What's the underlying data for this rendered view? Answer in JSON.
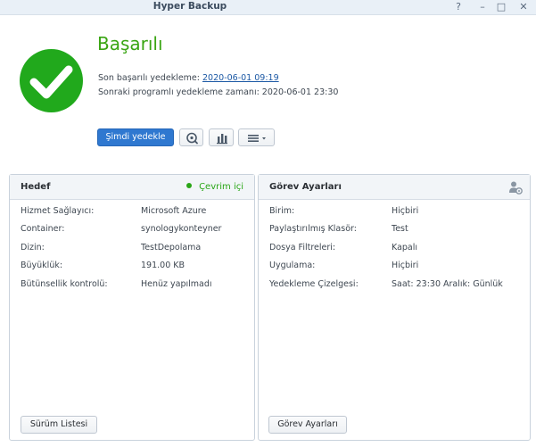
{
  "window": {
    "title": "Hyper Backup",
    "help_glyph": "?",
    "minimize_glyph": "–",
    "maximize_glyph": "□",
    "close_glyph": "✕"
  },
  "status": {
    "icon": "check-icon",
    "title": "Başarılı",
    "last_success_label": "Son başarılı yedekleme:",
    "last_success_value": "2020-06-01 09:19",
    "next_scheduled_text": "Sonraki programlı yedekleme zamanı: 2020-06-01 23:30"
  },
  "actions": {
    "backup_now": "Şimdi yedekle",
    "log_icon": "search-log-icon",
    "stats_icon": "bar-chart-icon",
    "menu_icon": "menu-icon"
  },
  "colors": {
    "success": "#21a91c",
    "primary": "#2f78d0",
    "online": "#2aa617"
  },
  "target_panel": {
    "title": "Hedef",
    "status": "Çevrim içi",
    "rows": [
      {
        "label": "Hizmet Sağlayıcı:",
        "value": "Microsoft Azure"
      },
      {
        "label": "Container:",
        "value": "synologykonteyner"
      },
      {
        "label": "Dizin:",
        "value": "TestDepolama"
      },
      {
        "label": "Büyüklük:",
        "value": "191.00 KB"
      },
      {
        "label": "Bütünsellik kontrolü:",
        "value": "Henüz yapılmadı"
      }
    ],
    "button": "Sürüm Listesi"
  },
  "task_panel": {
    "title": "Görev Ayarları",
    "icon": "user-role-icon",
    "rows": [
      {
        "label": "Birim:",
        "value": "Hiçbiri"
      },
      {
        "label": "Paylaştırılmış Klasör:",
        "value": "Test"
      },
      {
        "label": "Dosya Filtreleri:",
        "value": "Kapalı"
      },
      {
        "label": "Uygulama:",
        "value": "Hiçbiri"
      },
      {
        "label": "Yedekleme Çizelgesi:",
        "value": "Saat: 23:30 Aralık: Günlük"
      }
    ],
    "button": "Görev Ayarları"
  }
}
